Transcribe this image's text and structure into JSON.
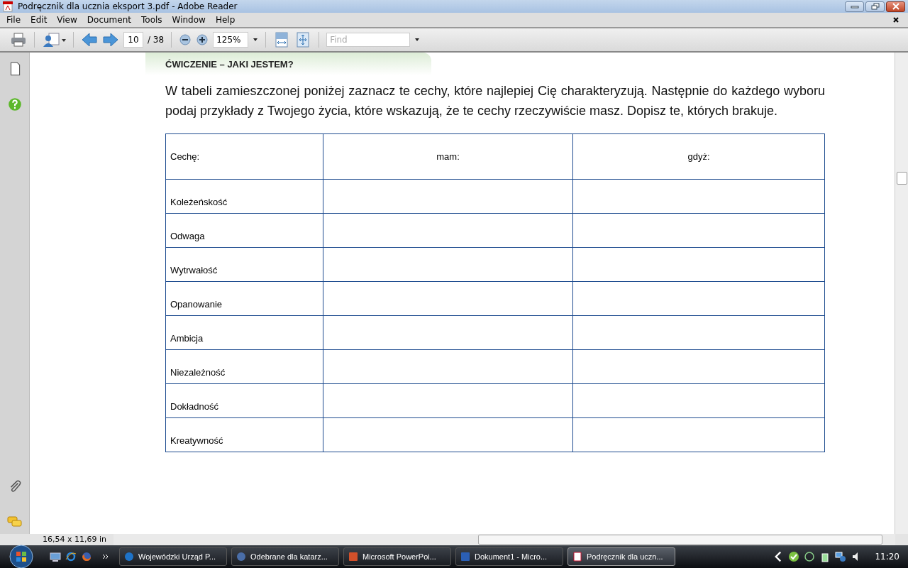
{
  "window": {
    "title": "Podręcznik dla ucznia eksport 3.pdf - Adobe Reader"
  },
  "menu": [
    "File",
    "Edit",
    "View",
    "Document",
    "Tools",
    "Window",
    "Help"
  ],
  "toolbar": {
    "page": "10",
    "page_total": "/ 38",
    "zoom": "125%",
    "find": {
      "placeholder": "Find"
    }
  },
  "document": {
    "heading": "ĆWICZENIE – JAKI JESTEM?",
    "intro": "W tabeli zamieszczonej poniżej zaznacz te cechy, które najlepiej Cię charakteryzują. Następnie do każdego wyboru podaj przykłady z Twojego życia, które wskazują, że te cechy rzeczywiście masz. Dopisz te, których brakuje.",
    "table": {
      "columns": [
        "Cechę:",
        "mam:",
        "gdyż:"
      ],
      "rows": [
        "Koleżeńskość",
        "Odwaga",
        "Wytrwałość",
        "Opanowanie",
        "Ambicja",
        "Niezależność",
        "Dokładność",
        "Kreatywność"
      ]
    }
  },
  "status_bar": {
    "page_size": "16,54 x 11,69 in"
  },
  "taskbar": {
    "items": [
      {
        "label": "Wojewódzki Urząd P...",
        "kind": "browser",
        "selected": false
      },
      {
        "label": "Odebrane dla katarz...",
        "kind": "mail",
        "selected": false
      },
      {
        "label": "Microsoft PowerPoi...",
        "kind": "slides",
        "selected": false
      },
      {
        "label": "Dokument1 - Micro...",
        "kind": "word",
        "selected": false
      },
      {
        "label": "Podręcznik dla uczn...",
        "kind": "pdf",
        "selected": true
      }
    ],
    "clock": "11:20"
  }
}
